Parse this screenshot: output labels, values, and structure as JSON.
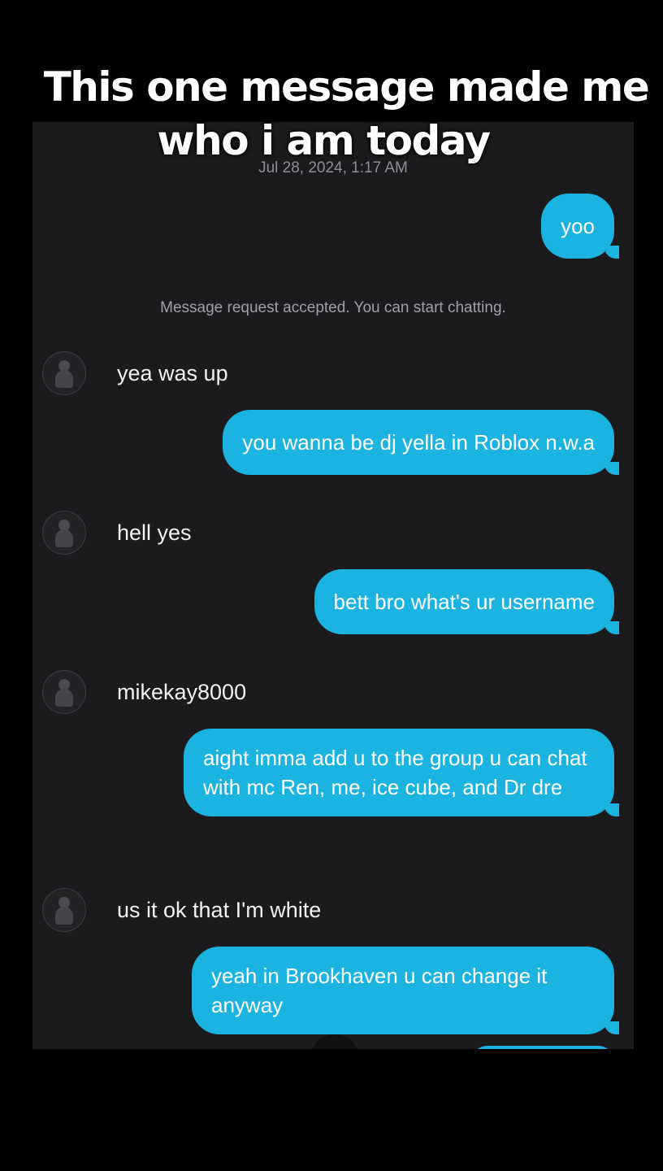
{
  "caption": {
    "line1": "This one message made me",
    "line2": "who i am today"
  },
  "chat": {
    "timestamp": "Jul 28, 2024, 1:17 AM",
    "system_note": "Message request accepted. You can start chatting.",
    "messages": [
      {
        "from": "me",
        "text": "yoo"
      },
      {
        "from": "them",
        "text": "yea was up"
      },
      {
        "from": "me",
        "text": "you wanna be dj yella in Roblox n.w.a"
      },
      {
        "from": "them",
        "text": "hell yes"
      },
      {
        "from": "me",
        "text": "bett bro what's ur username"
      },
      {
        "from": "them",
        "text": "mikekay8000"
      },
      {
        "from": "me",
        "text": "aight imma add u to the group u can chat with mc Ren, me, ice cube, and Dr dre"
      },
      {
        "from": "them",
        "text": "us it ok that I'm white"
      },
      {
        "from": "me",
        "text": "yeah in Brookhaven u can change it anyway"
      }
    ]
  },
  "colors": {
    "bubble": "#1bb3e0",
    "screen_bg": "#1b1b1d",
    "page_bg": "#000000"
  }
}
